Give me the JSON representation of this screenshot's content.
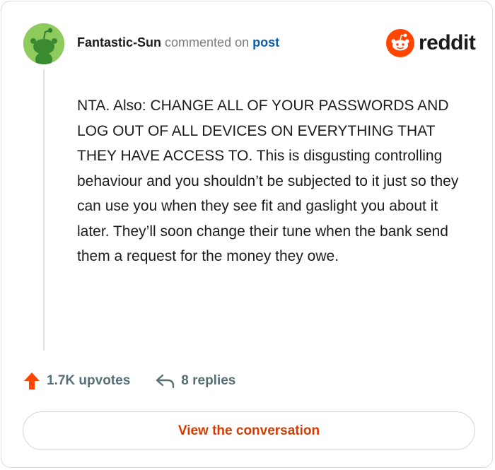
{
  "comment": {
    "username": "Fantastic-Sun",
    "action_text": "commented on",
    "post_link": "post",
    "body": "NTA. Also: CHANGE ALL OF YOUR PASSWORDS AND LOG OUT OF ALL DEVICES ON EVERYTHING THAT THEY HAVE ACCESS TO. This is disgusting controlling behaviour and you shouldn’t be subjected to it just so they can use you when they see fit and gaslight you about it later. They’ll soon change their tune when the bank send them a request for the money they owe."
  },
  "brand": {
    "wordmark": "reddit",
    "logo_icon": "reddit-snoo-icon",
    "color": "#ff4500"
  },
  "avatar": {
    "icon": "snoo-avatar-icon",
    "color": "#8fca5c"
  },
  "stats": {
    "upvotes": "1.7K upvotes",
    "upvote_icon": "upvote-arrow-icon",
    "upvote_color": "#ff4500",
    "replies": "8 replies",
    "reply_icon": "reply-arrow-icon"
  },
  "cta": {
    "label": "View the conversation",
    "color": "#d93a00"
  }
}
